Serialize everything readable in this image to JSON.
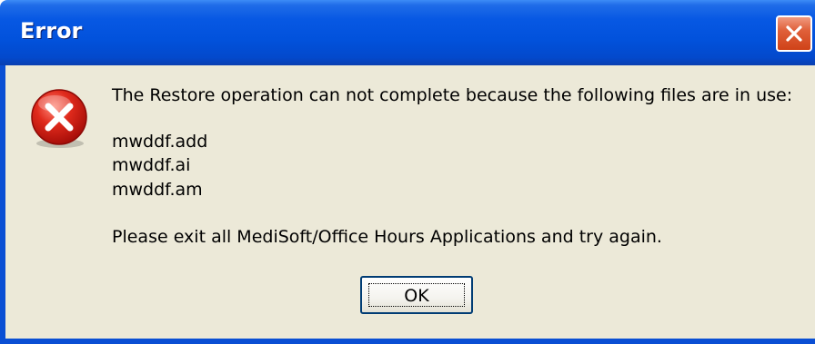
{
  "window": {
    "title": "Error"
  },
  "dialog": {
    "icon": "error-icon",
    "message": "The Restore operation can not complete because the following files are in use:",
    "files": [
      "mwddf.add",
      "mwddf.ai",
      "mwddf.am"
    ],
    "instruction": "Please exit all MediSoft/Office Hours Applications and try again.",
    "ok_label": "OK"
  },
  "colors": {
    "titlebar": "#0252dc",
    "dialog_background": "#ece9d8",
    "close_button": "#e0603a",
    "error_icon": "#d9201a"
  }
}
